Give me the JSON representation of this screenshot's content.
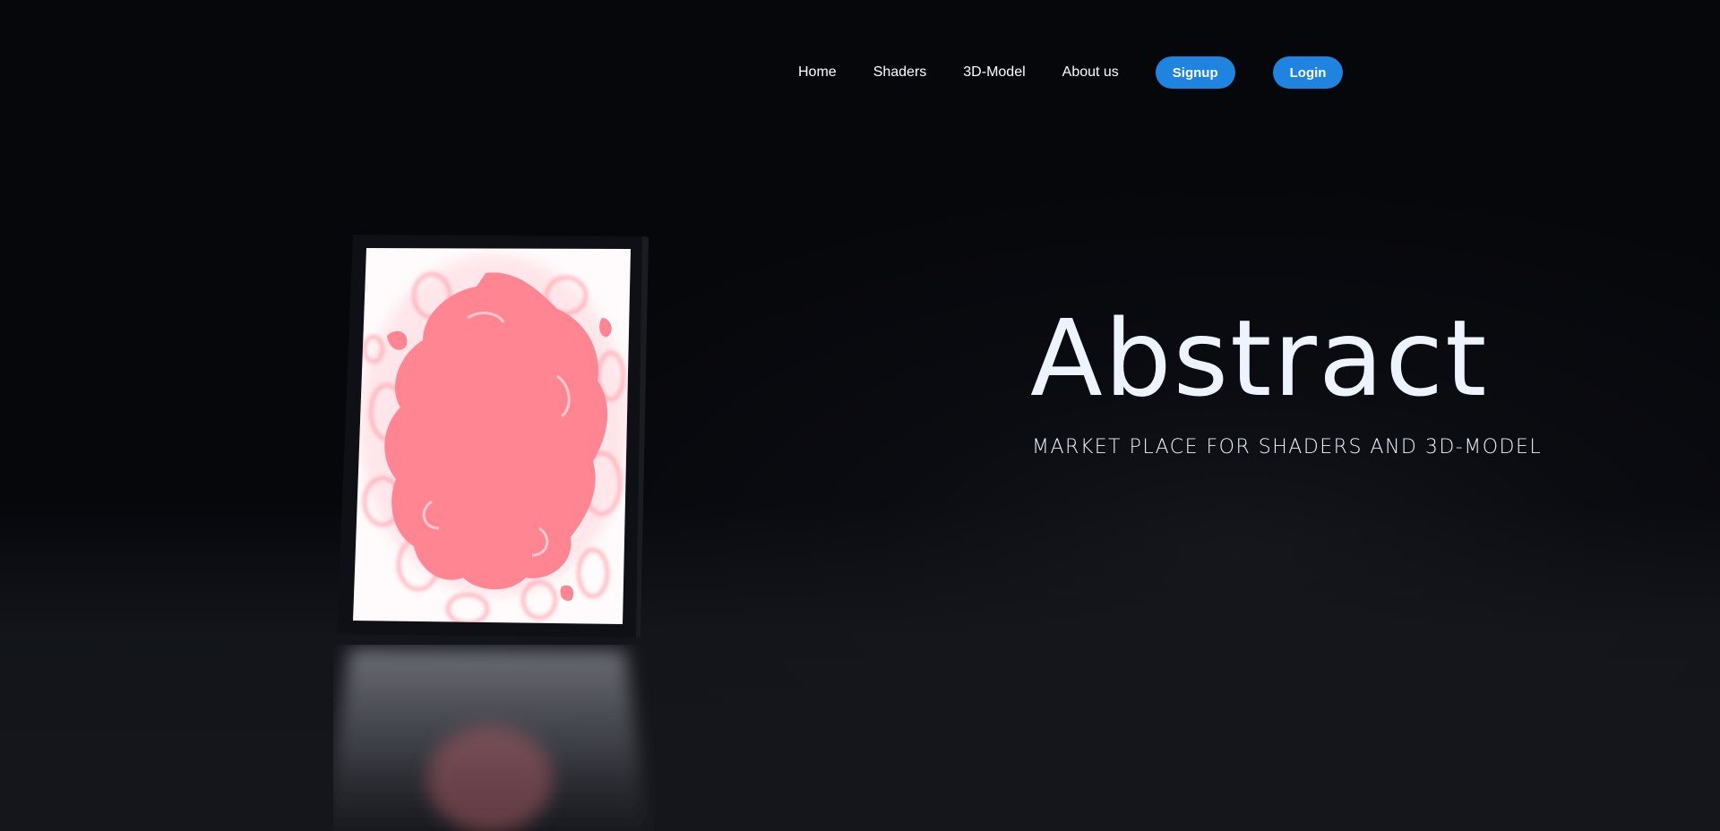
{
  "nav": {
    "links": [
      "Home",
      "Shaders",
      "3D-Model",
      "About us"
    ],
    "signup_label": "Signup",
    "login_label": "Login"
  },
  "hero": {
    "title": "Abstract",
    "subtitle": "MARKET PLACE FOR SHADERS AND 3D-MODEL"
  },
  "colors": {
    "background": "#06070b",
    "accent": "#1f83e0",
    "text": "#eef4ff",
    "artwork_blob": "#ff8593"
  },
  "icons": {
    "artwork": "abstract-shader-frame"
  }
}
